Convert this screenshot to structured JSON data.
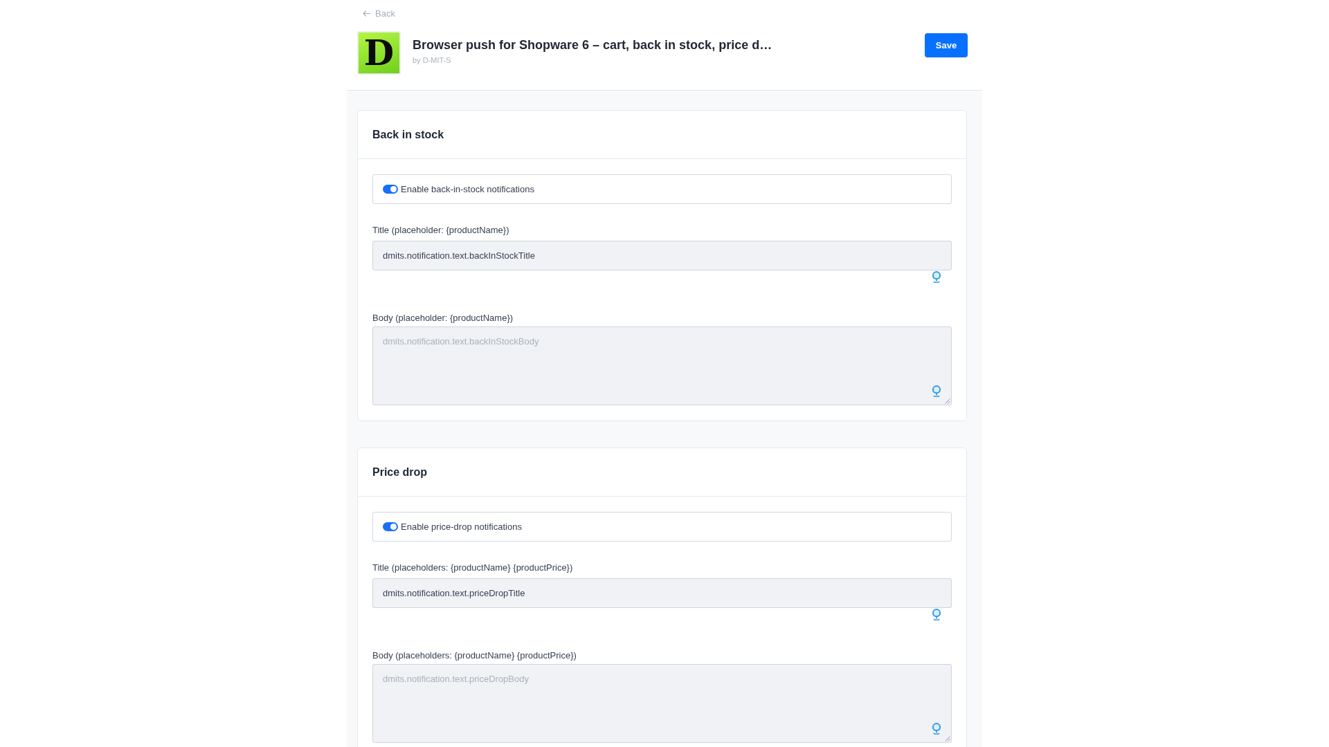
{
  "back_link": {
    "label": "Back"
  },
  "header": {
    "logo_text": "D",
    "title": "Browser push for Shopware 6 – cart, back in stock, price d…",
    "author": "by D-MIT-S"
  },
  "save_button": {
    "label": "Save"
  },
  "sections": [
    {
      "title": "Back in stock",
      "toggle": {
        "label": "Enable back-in-stock notifications",
        "on": true
      },
      "fields": [
        {
          "kind": "input",
          "label": "Title (placeholder: {productName})",
          "value": "dmits.notification.text.backInStockTitle"
        },
        {
          "kind": "textarea",
          "label": "Body (placeholder: {productName})",
          "placeholder": "dmits.notification.text.backInStockBody"
        }
      ]
    },
    {
      "title": "Price drop",
      "toggle": {
        "label": "Enable price-drop notifications",
        "on": true
      },
      "fields": [
        {
          "kind": "input",
          "label": "Title (placeholders: {productName} {productPrice})",
          "value": "dmits.notification.text.priceDropTitle"
        },
        {
          "kind": "textarea",
          "label": "Body (placeholders: {productName} {productPrice})",
          "placeholder": "dmits.notification.text.priceDropBody"
        }
      ]
    }
  ]
}
